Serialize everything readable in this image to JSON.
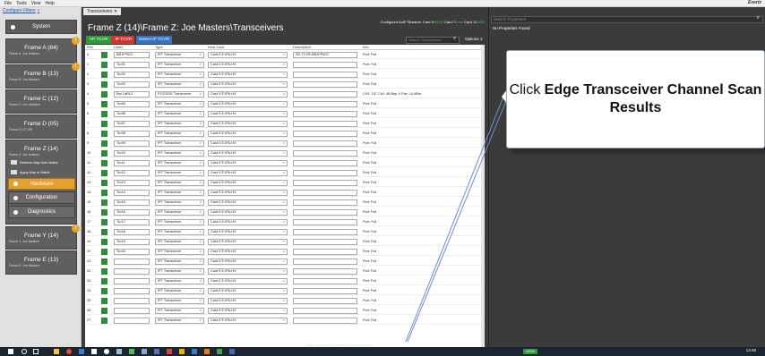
{
  "menu": {
    "items": [
      "File",
      "Tools",
      "View",
      "Help"
    ],
    "brand": "Evertz"
  },
  "left_panel": {
    "configure_label": "Configure Filters",
    "system_label": "System",
    "frames": [
      {
        "title": "Frame A (84)",
        "subtitle": "Frame A: Joe Masters",
        "badge": "!"
      },
      {
        "title": "Frame B (13)",
        "subtitle": "Frame B: Joe Masters",
        "badge": "!"
      },
      {
        "title": "Frame C (12)",
        "subtitle": "Frame C: Joe Masters"
      },
      {
        "title": "Frame D (05)",
        "subtitle": "Frame D: ET-IPA"
      },
      {
        "title": "Frame Z (14)",
        "subtitle": "Frame Z: Joe Masters"
      },
      {
        "title": "Frame Y (14)",
        "subtitle": "Frame Y: Joe Masters",
        "badge": "!"
      },
      {
        "title": "Frame E (13)",
        "subtitle": "Frame E: Joe Masters"
      }
    ],
    "frame_z_menu": [
      "Retrieve Map from Matrix",
      "Apply Map to Matrix"
    ],
    "hardware_label": "Hardware",
    "configuration_label": "Configuration",
    "diagnostics_label": "Diagnostics"
  },
  "tab": {
    "label": "Transceivers"
  },
  "main": {
    "title": "Frame Z (14)\\Frame Z: Joe Masters\\Transceivers",
    "streams_label": "Configured AoIP Streams:",
    "card_a": "Card 9:",
    "card_a_val": "63/64",
    "card_b": "Card 7:",
    "card_b_val": "0/64",
    "card_c": "Card 11:",
    "card_c_val": "0/64",
    "search_placeholder": "Search Transceivers",
    "options_label": "Options",
    "btn_add": "+IP TCVR",
    "btn_remove": "-IP TCVR",
    "btn_detect": "Detect IP TCVR",
    "columns": [
      "RIN",
      "Label",
      "Type",
      "Host Card",
      "Description",
      "Info"
    ],
    "rows": [
      {
        "rin": "0",
        "label": "BB1FPA22",
        "type": "IPT Transceiver",
        "host": "Card 5 E-IPA-HX",
        "desc": "SD-TCVR-BB1FPA22",
        "info": "Port: Full"
      },
      {
        "rin": "1",
        "label": "Tcv01",
        "type": "IPT Transceiver",
        "host": "Card 5 E-IPA-HX",
        "desc": "",
        "info": "Port: Full"
      },
      {
        "rin": "2",
        "label": "Tcv02",
        "type": "IPT Transceiver",
        "host": "Card 5 E-IPA-HX",
        "desc": "",
        "info": "Port: Full"
      },
      {
        "rin": "3",
        "label": "Tcv03",
        "type": "IPT Transceiver",
        "host": "Card 5 E-IPA-HX",
        "desc": "",
        "info": "Port: Full"
      },
      {
        "rin": "4",
        "label": "Bar LaRL2",
        "type": "FS-EDGE Transceiver",
        "host": "Card 5 E-IPA-HX",
        "desc": "",
        "info": "CH1: 157 Ch2: 48   Bay: 0    Pwr: 14 dBm"
      },
      {
        "rin": "5",
        "label": "Tcv05",
        "type": "IPT Transceiver",
        "host": "Card 5 E-IPA-HX",
        "desc": "",
        "info": "Port: Full"
      },
      {
        "rin": "6",
        "label": "Tcv06",
        "type": "IPT Transceiver",
        "host": "Card 5 E-IPA-HX",
        "desc": "",
        "info": "Port: Full"
      },
      {
        "rin": "7",
        "label": "Tcv07",
        "type": "IPT Transceiver",
        "host": "Card 5 E-IPA-HX",
        "desc": "",
        "info": "Port: Full"
      },
      {
        "rin": "8",
        "label": "Tcv08",
        "type": "IPT Transceiver",
        "host": "Card 5 E-IPA-HX",
        "desc": "",
        "info": "Port: Full"
      },
      {
        "rin": "9",
        "label": "Tcv09",
        "type": "IPT Transceiver",
        "host": "Card 5 E-IPA-HX",
        "desc": "",
        "info": "Port: Full"
      },
      {
        "rin": "10",
        "label": "Tcv10",
        "type": "IPT Transceiver",
        "host": "Card 5 E-IPA-HX",
        "desc": "",
        "info": "Port: Full"
      },
      {
        "rin": "11",
        "label": "Tcv11",
        "type": "IPT Transceiver",
        "host": "Card 5 E-IPA-HX",
        "desc": "",
        "info": "Port: Full"
      },
      {
        "rin": "12",
        "label": "Tcv12",
        "type": "IPT Transceiver",
        "host": "Card 5 E-IPA-HX",
        "desc": "",
        "info": "Port: Full"
      },
      {
        "rin": "13",
        "label": "Tcv13",
        "type": "IPT Transceiver",
        "host": "Card 5 E-IPA-HX",
        "desc": "",
        "info": "Port: Full"
      },
      {
        "rin": "14",
        "label": "Tcv14",
        "type": "IPT Transceiver",
        "host": "Card 5 E-IPA-HX",
        "desc": "",
        "info": "Port: Full"
      },
      {
        "rin": "15",
        "label": "Tcv15",
        "type": "IPT Transceiver",
        "host": "Card 5 E-IPA-HX",
        "desc": "",
        "info": "Port: Full"
      },
      {
        "rin": "16",
        "label": "Tcv16",
        "type": "IPT Transceiver",
        "host": "Card 5 E-IPA-HX",
        "desc": "",
        "info": "Port: Full"
      },
      {
        "rin": "17",
        "label": "Tcv17",
        "type": "IPT Transceiver",
        "host": "Card 5 E-IPA-HX",
        "desc": "",
        "info": "Port: Full"
      },
      {
        "rin": "18",
        "label": "Tcv18",
        "type": "IPT Transceiver",
        "host": "Card 5 E-IPA-HX",
        "desc": "",
        "info": "Port: Full"
      },
      {
        "rin": "19",
        "label": "Tcv19",
        "type": "IPT Transceiver",
        "host": "Card 5 E-IPA-HX",
        "desc": "",
        "info": "Port: Full"
      },
      {
        "rin": "20",
        "label": "Tcv20",
        "type": "IPT Transceiver",
        "host": "Card 5 E-IPA-HX",
        "desc": "",
        "info": "Port: Full"
      },
      {
        "rin": "21",
        "label": "",
        "type": "IPT Transceiver",
        "host": "Card 5 E-IPA-HX",
        "desc": "",
        "info": "Port: Full"
      },
      {
        "rin": "22",
        "label": "",
        "type": "IPT Transceiver",
        "host": "Card 5 E-IPA-HX",
        "desc": "",
        "info": "Port: Full"
      },
      {
        "rin": "23",
        "label": "",
        "type": "IPT Transceiver",
        "host": "Card 5 E-IPA-HX",
        "desc": "",
        "info": "Port: Full"
      },
      {
        "rin": "24",
        "label": "",
        "type": "IPT Transceiver",
        "host": "Card 5 E-IPA-HX",
        "desc": "",
        "info": "Port: Full"
      },
      {
        "rin": "25",
        "label": "",
        "type": "IPT Transceiver",
        "host": "Card 5 E-IPA-HX",
        "desc": "",
        "info": "Port: Full"
      },
      {
        "rin": "26",
        "label": "",
        "type": "IPT Transceiver",
        "host": "Card 5 E-IPA-HX",
        "desc": "",
        "info": "Port: Full"
      },
      {
        "rin": "27",
        "label": "",
        "type": "IPT Transceiver",
        "host": "Card 5 E-IPA-HX",
        "desc": "",
        "info": "Port: Full"
      }
    ],
    "bottom_link": "Edge Transceiver Channel Scan Results"
  },
  "properties": {
    "search_placeholder": "Search Properties",
    "empty_text": "No Properties Found"
  },
  "callout": {
    "prefix": "Click ",
    "bold": "Edge Transceiver Channel Scan Results"
  },
  "taskbar": {
    "tray_badge": "100%",
    "clock": "13:46"
  },
  "colors": {
    "accent_orange": "#e5a030",
    "green": "#2e9b3a",
    "red": "#d53330",
    "blue": "#3573c4",
    "dark_bg": "#3b3b3b"
  }
}
